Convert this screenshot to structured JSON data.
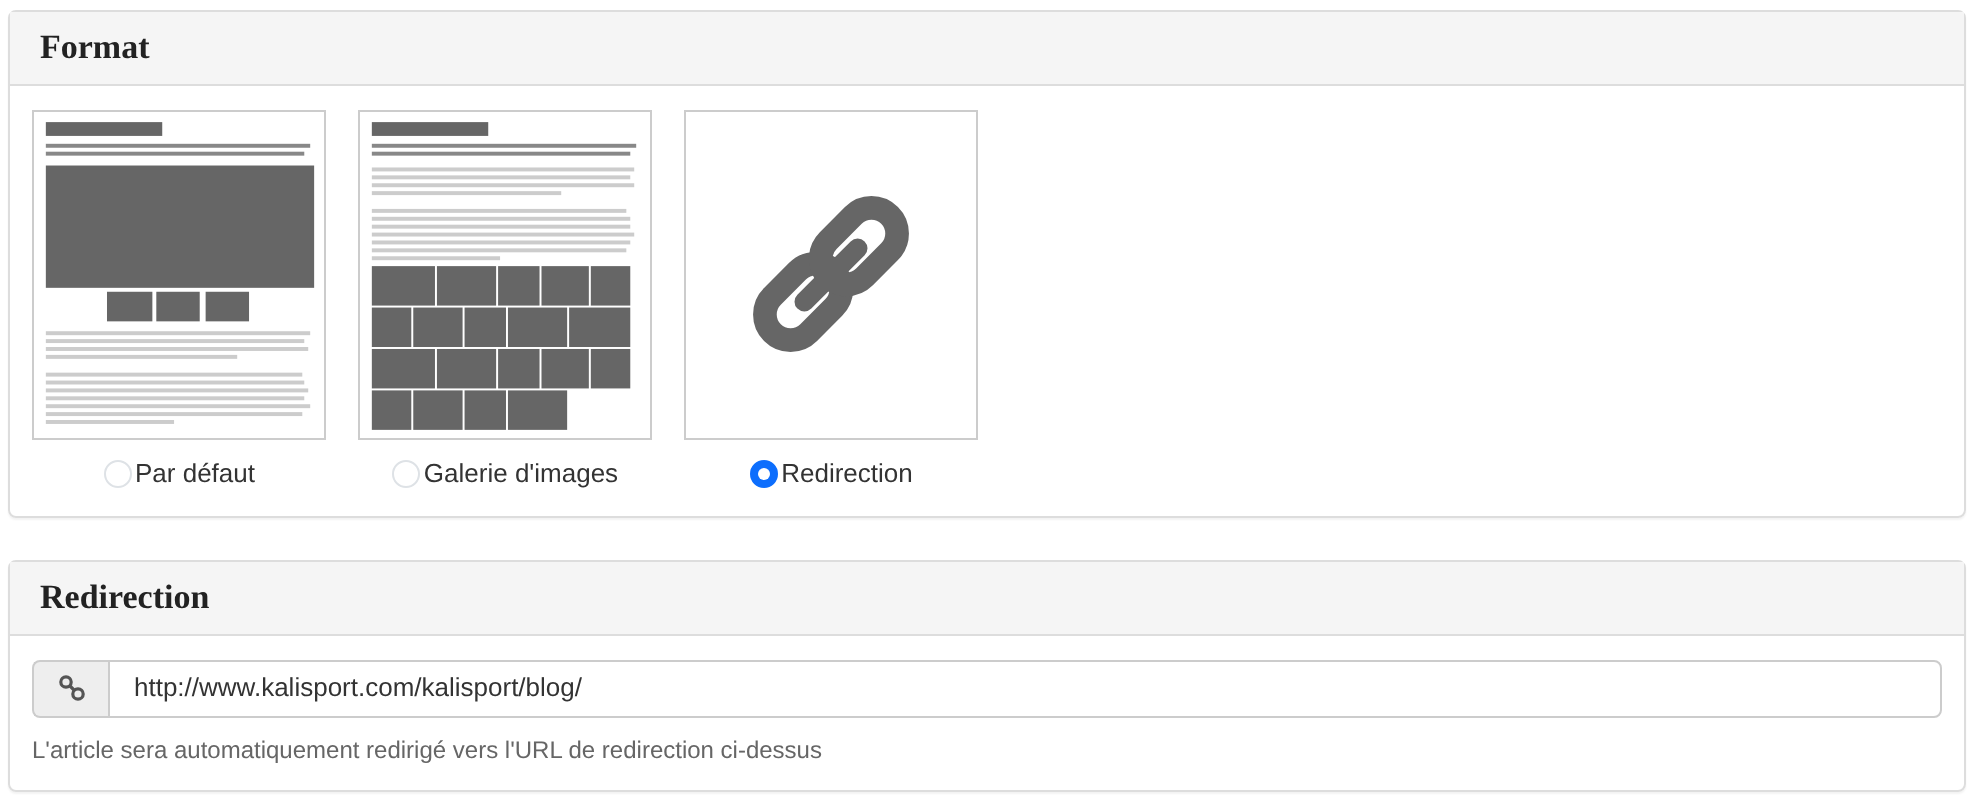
{
  "format_panel": {
    "title": "Format",
    "options": [
      {
        "kind": "default",
        "label": "Par défaut",
        "selected": false
      },
      {
        "kind": "gallery",
        "label": "Galerie d'images",
        "selected": false
      },
      {
        "kind": "redirect",
        "label": "Redirection",
        "selected": true
      }
    ]
  },
  "redirection_panel": {
    "title": "Redirection",
    "url_field": {
      "value": "http://www.kalisport.com/kalisport/blog/"
    },
    "help_text": "L'article sera automatiquement redirigé vers l'URL de redirection ci-dessus"
  }
}
